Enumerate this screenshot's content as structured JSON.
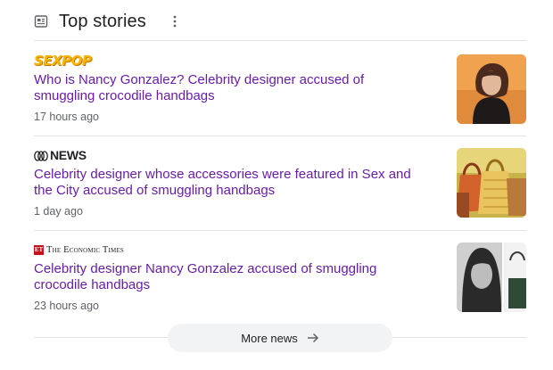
{
  "header": {
    "title": "Top stories",
    "icon": "news-icon",
    "menu_icon": "more-vert-icon"
  },
  "stories": [
    {
      "source": "SEXPOP",
      "headline": "Who is Nancy Gonzalez? Celebrity designer accused of smuggling crocodile handbags",
      "time": "17 hours ago",
      "thumbnail": "photo-woman-portrait"
    },
    {
      "source": "NEWS",
      "headline": "Celebrity designer whose accessories were featured in Sex and the City accused of smuggling handbags",
      "time": "1 day ago",
      "thumbnail": "photo-handbags"
    },
    {
      "source": "The Economic Times",
      "source_badge": "ET",
      "headline": "Celebrity designer Nancy Gonzalez accused of smuggling crocodile handbags",
      "time": "23 hours ago",
      "thumbnail": "photo-bw-portrait-handbag"
    }
  ],
  "more_news": {
    "label": "More news",
    "icon": "arrow-right-icon"
  },
  "colors": {
    "headline": "#681da8",
    "meta": "#5f6368",
    "divider": "#e3e3e3",
    "button_bg": "#f1f3f4"
  }
}
